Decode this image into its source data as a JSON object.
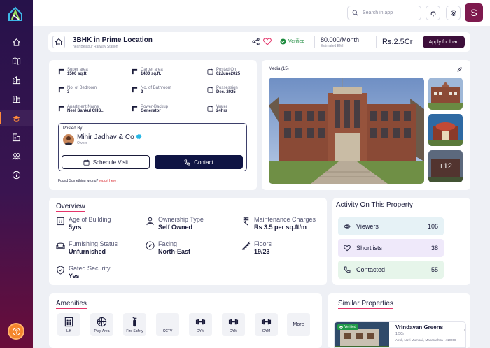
{
  "colors": {
    "sidebar_top": "#26124a",
    "sidebar_bottom": "#6a0d3a",
    "accent_orange": "#ff8a3a",
    "primary_dark": "#0f1444",
    "loan_button": "#3d0f3a",
    "avatar_bg": "#7e1a4e",
    "verified_green": "#1b8a3c",
    "underline_pink": "#e4346a",
    "viewers_bg": "#e6f2f6",
    "shortlists_bg": "#efe9fa",
    "contacted_bg": "#e6f5ea"
  },
  "header": {
    "search_placeholder": "Search in app",
    "avatar_initial": "S"
  },
  "property": {
    "title": "3BHK in Prime Location",
    "subtitle": "near Belapur Railway Station",
    "verified": "Verified",
    "emi_value": "80.000/Month",
    "emi_label": "Estimated EMI",
    "price": "Rs.2.5Cr",
    "loan_button": "Apply for loan"
  },
  "specs": [
    {
      "label": "Super area",
      "value": "1500 sq.ft.",
      "icon": "area-icon"
    },
    {
      "label": "Carpet area",
      "value": "1400 sq.ft.",
      "icon": "area-icon"
    },
    {
      "label": "Posted On",
      "value": "02June2025",
      "icon": "calendar-icon"
    },
    {
      "label": "No. of Bedroom",
      "value": "3",
      "icon": "area-icon"
    },
    {
      "label": "No. of Bathroom",
      "value": "2",
      "icon": "area-icon"
    },
    {
      "label": "Possession",
      "value": "Dec. 2025",
      "icon": "calendar-icon"
    },
    {
      "label": "Apartment Name",
      "value": "Neel Sankul CHS...",
      "icon": "area-icon"
    },
    {
      "label": "Power-Backup",
      "value": "Generator",
      "icon": "area-icon"
    },
    {
      "label": "Water",
      "value": "24hrs",
      "icon": "calendar-icon"
    }
  ],
  "posted_by": {
    "label": "Posted By",
    "name": "Mihir Jadhav & Co",
    "role": "Owner",
    "schedule_button": "Schedule Visit",
    "contact_button": "Contact"
  },
  "report": {
    "text": "Found Something wrong?",
    "link": "report here ."
  },
  "media": {
    "label": "Media (15)",
    "more_count": "+12"
  },
  "overview": {
    "title": "Overview",
    "items": [
      {
        "label": "Age of Building",
        "value": "5yrs",
        "icon": "building-icon"
      },
      {
        "label": "Ownership Type",
        "value": "Self Owned",
        "icon": "person-icon"
      },
      {
        "label": "Maintenance Charges",
        "value": "Rs 3.5 per sq.ft/m",
        "icon": "rupee-icon"
      },
      {
        "label": "Furnishing Status",
        "value": "Unfurnished",
        "icon": "sofa-icon"
      },
      {
        "label": "Facing",
        "value": "North-East",
        "icon": "compass-icon"
      },
      {
        "label": "Floors",
        "value": "19/23",
        "icon": "stairs-icon"
      },
      {
        "label": "Gated Security",
        "value": "Yes",
        "icon": "shield-icon"
      }
    ]
  },
  "activity": {
    "title": "Activity On This Property",
    "rows": [
      {
        "label": "Viewers",
        "value": "106",
        "icon": "eye-icon"
      },
      {
        "label": "Shortlists",
        "value": "38",
        "icon": "heart-icon"
      },
      {
        "label": "Contacted",
        "value": "55",
        "icon": "phone-icon"
      }
    ]
  },
  "amenities": {
    "title": "Amenities",
    "items": [
      {
        "label": "Lift",
        "icon": "lift-icon"
      },
      {
        "label": "Play-Area",
        "icon": "ball-icon"
      },
      {
        "label": "Fire Safety",
        "icon": "fire-extinguisher-icon"
      },
      {
        "label": "CCTV",
        "icon": "cctv-icon"
      },
      {
        "label": "GYM",
        "icon": "dumbbell-icon"
      },
      {
        "label": "GYM",
        "icon": "dumbbell-icon"
      },
      {
        "label": "GYM",
        "icon": "dumbbell-icon"
      }
    ],
    "more": "More"
  },
  "similar": {
    "title": "Similar Properties",
    "card": {
      "badge": "Verified",
      "name": "Vrindavan Greens",
      "price": "1.5Cr",
      "location": "Airoli, Navi Mumbai , Maharashtra , 410208"
    }
  }
}
